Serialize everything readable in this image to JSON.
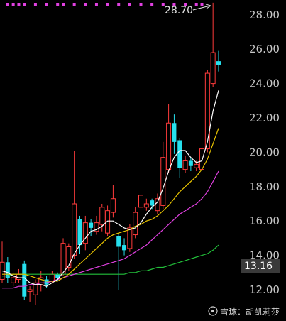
{
  "chart_data": {
    "type": "candlestick",
    "y_axis": {
      "ticks": [
        "12.00",
        "14.00",
        "16.00",
        "18.00",
        "20.00",
        "22.00",
        "24.00",
        "26.00",
        "28.00"
      ],
      "min": 11.2,
      "max": 29.0,
      "position": "right"
    },
    "grid": false,
    "current_price": "13.16",
    "peak_label": "28.70",
    "colors": {
      "up": "#ff3b3b",
      "down": "#26e0ee",
      "ma5": "#ffffff",
      "ma10": "#e6c200",
      "ma20": "#e040e0",
      "ma60": "#22c03a",
      "marker": "#e040e0"
    },
    "candles": [
      {
        "o": 12.6,
        "c": 13.6,
        "h": 14.8,
        "l": 12.4
      },
      {
        "o": 13.6,
        "c": 12.7,
        "h": 13.9,
        "l": 12.4
      },
      {
        "o": 12.4,
        "c": 12.7,
        "h": 13.0,
        "l": 12.2
      },
      {
        "o": 12.6,
        "c": 12.9,
        "h": 13.2,
        "l": 12.4
      },
      {
        "o": 13.5,
        "c": 11.6,
        "h": 13.7,
        "l": 11.4
      },
      {
        "o": 11.9,
        "c": 12.0,
        "h": 12.2,
        "l": 11.3
      },
      {
        "o": 11.7,
        "c": 12.4,
        "h": 12.6,
        "l": 11.1
      },
      {
        "o": 12.3,
        "c": 12.7,
        "h": 13.1,
        "l": 11.9
      },
      {
        "o": 12.6,
        "c": 12.3,
        "h": 12.8,
        "l": 12.1
      },
      {
        "o": 12.5,
        "c": 12.9,
        "h": 13.1,
        "l": 12.4
      },
      {
        "o": 12.9,
        "c": 12.7,
        "h": 13.0,
        "l": 12.5
      },
      {
        "o": 12.9,
        "c": 14.7,
        "h": 15.0,
        "l": 12.8
      },
      {
        "o": 13.3,
        "c": 14.5,
        "h": 14.7,
        "l": 13.1
      },
      {
        "o": 14.0,
        "c": 17.0,
        "h": 20.1,
        "l": 13.8
      },
      {
        "o": 16.1,
        "c": 14.6,
        "h": 16.3,
        "l": 14.1
      },
      {
        "o": 14.7,
        "c": 15.9,
        "h": 16.3,
        "l": 14.3
      },
      {
        "o": 15.9,
        "c": 15.6,
        "h": 16.1,
        "l": 15.1
      },
      {
        "o": 15.4,
        "c": 15.9,
        "h": 16.3,
        "l": 15.2
      },
      {
        "o": 15.8,
        "c": 16.8,
        "h": 17.0,
        "l": 15.4
      },
      {
        "o": 15.3,
        "c": 16.6,
        "h": 16.9,
        "l": 15.1
      },
      {
        "o": 16.5,
        "c": 17.3,
        "h": 18.1,
        "l": 16.2
      },
      {
        "o": 15.1,
        "c": 14.5,
        "h": 15.3,
        "l": 12.0
      },
      {
        "o": 14.6,
        "c": 14.3,
        "h": 15.0,
        "l": 14.0
      },
      {
        "o": 14.4,
        "c": 15.6,
        "h": 15.8,
        "l": 14.2
      },
      {
        "o": 15.2,
        "c": 16.5,
        "h": 16.8,
        "l": 15.0
      },
      {
        "o": 16.8,
        "c": 17.5,
        "h": 17.8,
        "l": 16.6
      },
      {
        "o": 16.8,
        "c": 17.0,
        "h": 17.3,
        "l": 16.6
      },
      {
        "o": 17.2,
        "c": 16.9,
        "h": 17.3,
        "l": 16.7
      },
      {
        "o": 16.6,
        "c": 17.3,
        "h": 17.6,
        "l": 16.4
      },
      {
        "o": 16.9,
        "c": 19.7,
        "h": 20.6,
        "l": 16.7
      },
      {
        "o": 19.0,
        "c": 21.7,
        "h": 22.8,
        "l": 18.8
      },
      {
        "o": 21.7,
        "c": 20.6,
        "h": 22.2,
        "l": 19.9
      },
      {
        "o": 20.7,
        "c": 19.1,
        "h": 20.8,
        "l": 18.5
      },
      {
        "o": 19.0,
        "c": 19.5,
        "h": 19.8,
        "l": 18.8
      },
      {
        "o": 19.5,
        "c": 19.2,
        "h": 19.7,
        "l": 18.9
      },
      {
        "o": 19.1,
        "c": 19.3,
        "h": 19.5,
        "l": 18.9
      },
      {
        "o": 19.0,
        "c": 20.2,
        "h": 20.6,
        "l": 18.9
      },
      {
        "o": 20.2,
        "c": 24.6,
        "h": 24.8,
        "l": 20.0
      },
      {
        "o": 24.0,
        "c": 25.8,
        "h": 28.7,
        "l": 23.8
      },
      {
        "o": 25.3,
        "c": 25.1,
        "h": 25.9,
        "l": 24.7
      }
    ],
    "ma5": [
      13.1,
      13.0,
      12.8,
      12.7,
      12.7,
      12.4,
      12.3,
      12.3,
      12.2,
      12.4,
      12.6,
      13.0,
      13.4,
      14.1,
      14.6,
      15.0,
      15.4,
      15.5,
      15.7,
      16.0,
      16.0,
      15.8,
      15.6,
      15.5,
      15.6,
      15.9,
      16.4,
      16.8,
      17.1,
      17.9,
      18.9,
      19.7,
      20.1,
      20.1,
      19.7,
      19.4,
      19.5,
      20.6,
      22.4,
      23.6
    ],
    "ma10": [
      12.9,
      12.9,
      12.9,
      12.9,
      12.9,
      12.8,
      12.7,
      12.6,
      12.5,
      12.5,
      12.5,
      12.7,
      12.9,
      13.2,
      13.5,
      13.8,
      14.1,
      14.4,
      14.7,
      15.0,
      15.2,
      15.3,
      15.4,
      15.5,
      15.7,
      15.8,
      16.0,
      16.1,
      16.3,
      16.6,
      16.9,
      17.3,
      17.7,
      18.0,
      18.3,
      18.6,
      19.0,
      19.6,
      20.5,
      21.4
    ],
    "ma20": [
      12.1,
      12.1,
      12.1,
      12.2,
      12.2,
      12.3,
      12.3,
      12.4,
      12.4,
      12.5,
      12.6,
      12.7,
      12.8,
      12.9,
      13.0,
      13.1,
      13.2,
      13.3,
      13.4,
      13.5,
      13.6,
      13.7,
      13.8,
      14.0,
      14.2,
      14.4,
      14.6,
      14.9,
      15.2,
      15.5,
      15.8,
      16.1,
      16.4,
      16.6,
      16.8,
      17.0,
      17.3,
      17.7,
      18.3,
      18.9
    ],
    "ma60": [
      12.8,
      12.8,
      12.9,
      12.9,
      12.9,
      12.9,
      12.9,
      12.9,
      12.9,
      12.9,
      12.9,
      12.9,
      12.9,
      12.9,
      12.9,
      12.9,
      12.9,
      12.9,
      12.9,
      12.9,
      12.9,
      12.9,
      12.9,
      13.0,
      13.0,
      13.1,
      13.1,
      13.2,
      13.3,
      13.3,
      13.4,
      13.5,
      13.6,
      13.7,
      13.8,
      13.9,
      14.0,
      14.1,
      14.3,
      14.6
    ],
    "top_markers": [
      1,
      2,
      3,
      4,
      6,
      8,
      10,
      11,
      13,
      15,
      17,
      19,
      21,
      23,
      25,
      27,
      29,
      31,
      33,
      35,
      36
    ]
  },
  "watermark": "雪球：胡凯莉莎"
}
